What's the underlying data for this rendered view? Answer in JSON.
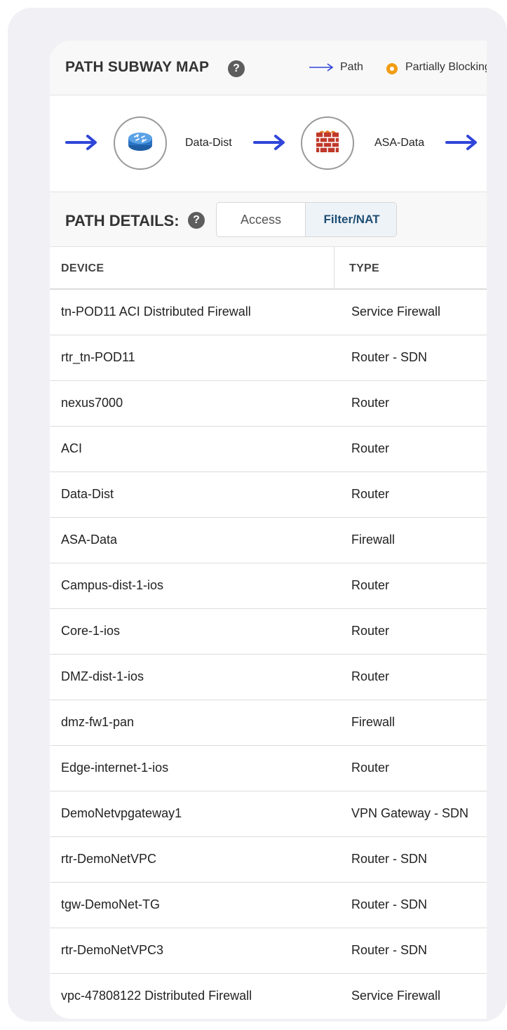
{
  "subway": {
    "title": "PATH SUBWAY MAP",
    "help": "?",
    "legend_path_label": "Path",
    "legend_partial_label": "Partially Blocking",
    "nodes": [
      {
        "label": "Data-Dist",
        "icon": "router-icon"
      },
      {
        "label": "ASA-Data",
        "icon": "firewall-icon"
      }
    ]
  },
  "details": {
    "title": "PATH DETAILS:",
    "help": "?",
    "tabs": [
      "Access",
      "Filter/NAT"
    ],
    "active_tab": "Filter/NAT"
  },
  "table": {
    "headers": [
      "DEVICE",
      "TYPE"
    ],
    "rows": [
      {
        "device": "tn-POD11 ACI Distributed Firewall",
        "type": "Service Firewall"
      },
      {
        "device": "rtr_tn-POD11",
        "type": "Router - SDN"
      },
      {
        "device": "nexus7000",
        "type": "Router"
      },
      {
        "device": "ACI",
        "type": "Router"
      },
      {
        "device": "Data-Dist",
        "type": "Router"
      },
      {
        "device": "ASA-Data",
        "type": "Firewall"
      },
      {
        "device": "Campus-dist-1-ios",
        "type": "Router"
      },
      {
        "device": "Core-1-ios",
        "type": "Router"
      },
      {
        "device": "DMZ-dist-1-ios",
        "type": "Router"
      },
      {
        "device": "dmz-fw1-pan",
        "type": "Firewall"
      },
      {
        "device": "Edge-internet-1-ios",
        "type": "Router"
      },
      {
        "device": "DemoNetvpgateway1",
        "type": "VPN Gateway - SDN"
      },
      {
        "device": "rtr-DemoNetVPC",
        "type": "Router - SDN"
      },
      {
        "device": "tgw-DemoNet-TG",
        "type": "Router - SDN"
      },
      {
        "device": "rtr-DemoNetVPC3",
        "type": "Router - SDN"
      },
      {
        "device": "vpc-47808122 Distributed Firewall",
        "type": "Service Firewall"
      }
    ]
  },
  "colors": {
    "path_arrow": "#2f45d9",
    "partial_blocking": "#f39c12",
    "active_tab_text": "#1d4e74"
  }
}
